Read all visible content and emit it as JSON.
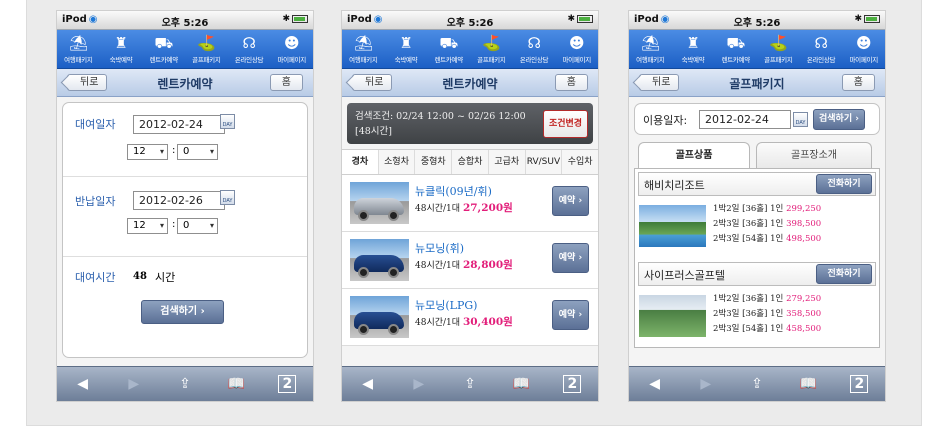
{
  "status": {
    "carrier": "iPod",
    "time": "오후 5:26",
    "bluetooth": "✱"
  },
  "nav": [
    "여행패키지",
    "숙박예약",
    "렌트카예약",
    "골프패키지",
    "온라인상담",
    "마이페이지"
  ],
  "nav_icons": [
    "beach-icon",
    "building-icon",
    "car-icon",
    "golf-icon",
    "headset-icon",
    "person-icon"
  ],
  "toolbar": {
    "tabs_count": "2"
  },
  "common": {
    "back": "뒤로",
    "home": "홈"
  },
  "screen1": {
    "title": "렌트카예약",
    "pickup_label": "대여일자",
    "pickup_date": "2012-02-24",
    "pickup_hour": "12",
    "pickup_min": "0",
    "return_label": "반납일자",
    "return_date": "2012-02-26",
    "return_hour": "12",
    "return_min": "0",
    "duration_label": "대여시간",
    "duration_value": "48",
    "duration_unit": "시간",
    "search_button": "검색하기",
    "colon": ":",
    "cal_label": "DAY"
  },
  "screen2": {
    "title": "렌트카예약",
    "condition": "검색조건: 02/24 12:00 ~ 02/26 12:00 [48시간]",
    "change_button": "조건변경",
    "categories": [
      "경차",
      "소형차",
      "중형차",
      "승합차",
      "고급차",
      "RV/SUV",
      "수입차"
    ],
    "cars": [
      {
        "name": "뉴클릭(09년/휘)",
        "price_prefix": "48시간/1대",
        "price": "27,200원",
        "reserve": "예약"
      },
      {
        "name": "뉴모닝(휘)",
        "price_prefix": "48시간/1대",
        "price": "28,800원",
        "reserve": "예약"
      },
      {
        "name": "뉴모닝(LPG)",
        "price_prefix": "48시간/1대",
        "price": "30,400원",
        "reserve": "예약"
      }
    ]
  },
  "screen3": {
    "title": "골프패키지",
    "date_label": "이용일자:",
    "date_value": "2012-02-24",
    "search_button": "검색하기",
    "tab_products": "골프상품",
    "tab_courses": "골프장소개",
    "call_button": "전화하기",
    "resorts": [
      {
        "name": "해비치리조트",
        "lines": [
          {
            "label": "1박2일 [36홀] 1인",
            "price": "299,250"
          },
          {
            "label": "2박3일 [36홀] 1인",
            "price": "398,500"
          },
          {
            "label": "2박3일 [54홀] 1인",
            "price": "498,500"
          }
        ]
      },
      {
        "name": "사이프러스골프텔",
        "lines": [
          {
            "label": "1박2일 [36홀] 1인",
            "price": "279,250"
          },
          {
            "label": "2박3일 [36홀] 1인",
            "price": "358,500"
          },
          {
            "label": "2박3일 [54홀] 1인",
            "price": "458,500"
          }
        ]
      }
    ]
  }
}
